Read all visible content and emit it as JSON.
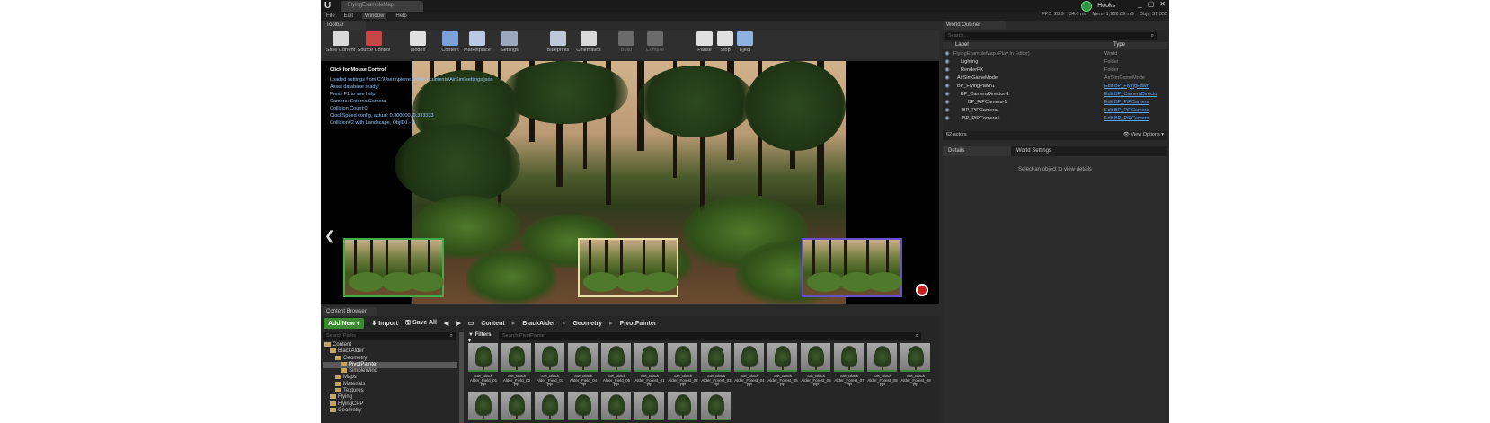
{
  "window": {
    "doc_tab": "FlyingExampleMap",
    "top_right_label": "Hooks",
    "win_controls": [
      "_",
      "▢",
      "✕"
    ]
  },
  "menu": [
    "File",
    "Edit",
    "Window",
    "Help"
  ],
  "stats": [
    "FPS: 28.9",
    "34.6 ms",
    "Mem: 1,902.89 mB",
    "Objs: 31 352"
  ],
  "toolbar": {
    "tab_label": "Toolbar",
    "buttons": [
      {
        "label": "Save Current",
        "icon": "save-icon",
        "color": "#d9d9d9"
      },
      {
        "label": "Source Control",
        "icon": "source-control-icon",
        "color": "#c64646"
      },
      {
        "label": "Modes",
        "icon": "modes-icon",
        "color": "#e0e0e0"
      },
      {
        "label": "Content",
        "icon": "content-icon",
        "color": "#7aa2d8"
      },
      {
        "label": "Marketplace",
        "icon": "marketplace-icon",
        "color": "#b9c9e6"
      },
      {
        "label": "Settings",
        "icon": "settings-icon",
        "color": "#9ca8c0"
      },
      {
        "label": "Blueprints",
        "icon": "blueprints-icon",
        "color": "#bfc8d8"
      },
      {
        "label": "Cinematics",
        "icon": "cinematics-icon",
        "color": "#d8d8d8"
      },
      {
        "label": "Build",
        "icon": "build-icon",
        "color": "#6b6b6b"
      },
      {
        "label": "Compile",
        "icon": "compile-icon",
        "color": "#6b6b6b"
      },
      {
        "label": "Pause",
        "icon": "pause-icon",
        "color": "#e0e0e0"
      },
      {
        "label": "Stop",
        "icon": "stop-icon",
        "color": "#e0e0e0"
      },
      {
        "label": "Eject",
        "icon": "eject-icon",
        "color": "#8fb3e0"
      }
    ]
  },
  "viewport": {
    "click_hint": "Click for Mouse Control",
    "log": [
      "Loaded settings from C:\\Users\\pierre.kelly\\Documents\\AirSim\\settings.json",
      "Asset database ready!",
      "Press F1 to see help",
      "Camera: ExternalCamera",
      "Collision Count:0",
      "ClockSpeed config, actual: 0.300000, 0.333333",
      "Collision#2 with Landscape, ObjID1 - 1"
    ],
    "left_arrow": "❮",
    "right_arrow": "❯",
    "pip_border_colors": [
      "#3fae4a",
      "#e8e0a8",
      "#6a4ed0"
    ]
  },
  "outliner": {
    "tab_label": "World Outliner",
    "search_placeholder": "Search...",
    "columns": {
      "label": "Label",
      "type": "Type"
    },
    "rows": [
      {
        "name": "FlyingExampleMap (Play In Editor)",
        "type": "World",
        "link": false,
        "dim": true
      },
      {
        "name": "Lighting",
        "type": "Folder",
        "link": false
      },
      {
        "name": "RenderFX",
        "type": "Folder",
        "link": false
      },
      {
        "name": "AirSimGameMode",
        "type": "AirSimGameMode",
        "link": false
      },
      {
        "name": "BP_FlyingPawn1",
        "type": "Edit BP_FlyingPawn",
        "link": true
      },
      {
        "name": "BP_CameraDirector-1",
        "type": "Edit BP_CameraDirecto",
        "link": true
      },
      {
        "name": "BP_PiPCamera-1",
        "type": "Edit BP_PiPCamera",
        "link": true
      },
      {
        "name": "BP_PiPCamera",
        "type": "Edit BP_PiPCamera",
        "link": true
      },
      {
        "name": "BP_PiPCamera1",
        "type": "Edit BP_PiPCamera",
        "link": true
      }
    ],
    "actor_count": "62 actors",
    "view_options": "View Options"
  },
  "details": {
    "tabs": [
      "Details",
      "World Settings"
    ],
    "empty_message": "Select an object to view details"
  },
  "content_browser": {
    "tab_label": "Content Browser",
    "add_new": "Add New",
    "import": "Import",
    "save_all": "Save All",
    "breadcrumb": [
      "Content",
      "BlackAlder",
      "Geometry",
      "PivotPainter"
    ],
    "paths_search_placeholder": "Search Paths",
    "assets_search_placeholder": "Search PivotPainter",
    "filters_label": "Filters",
    "tree": [
      {
        "label": "Content",
        "indent": 0
      },
      {
        "label": "BlackAlder",
        "indent": 1
      },
      {
        "label": "Geometry",
        "indent": 2
      },
      {
        "label": "PivotPainter",
        "indent": 3,
        "selected": true
      },
      {
        "label": "SimpleWind",
        "indent": 3
      },
      {
        "label": "Maps",
        "indent": 2
      },
      {
        "label": "Materials",
        "indent": 2
      },
      {
        "label": "Textures",
        "indent": 2
      },
      {
        "label": "Flying",
        "indent": 1
      },
      {
        "label": "FlyingCPP",
        "indent": 1
      },
      {
        "label": "Geometry",
        "indent": 1
      }
    ],
    "assets_row1": [
      "SM_Black Alder_Field_01 PP",
      "SM_Black Alder_Field_02 PP",
      "SM_Black Alder_Field_03 PP",
      "SM_Black Alder_Field_04 PP",
      "SM_Black Alder_Field_05 PP",
      "SM_Black Alder_Forest_01 PP",
      "SM_Black Alder_Forest_02 PP",
      "SM_Black Alder_Forest_03 PP",
      "SM_Black Alder_Forest_04 PP",
      "SM_Black Alder_Forest_05 PP",
      "SM_Black Alder_Forest_06 PP",
      "SM_Black Alder_Forest_07 PP",
      "SM_Black Alder_Forest_08 PP",
      "SM_Black Alder_Forest_09 PP"
    ],
    "assets_row2_count": 8
  }
}
